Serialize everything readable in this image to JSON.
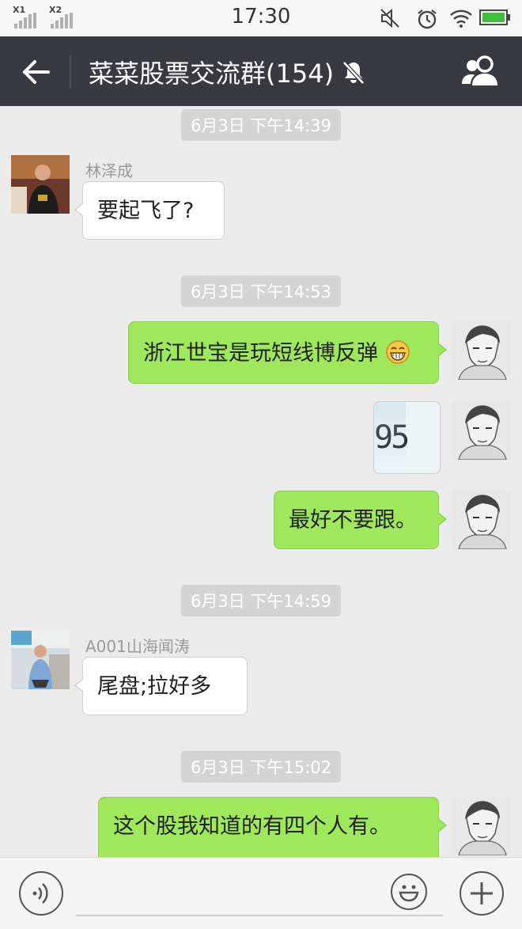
{
  "status_bar": {
    "time": "17:30",
    "sim1_label": "X1",
    "sim2_label": "X2",
    "icons": [
      "signal-icon",
      "signal-icon",
      "mute-icon",
      "alarm-icon",
      "wifi-icon",
      "battery-icon"
    ]
  },
  "header": {
    "title": "菜菜股票交流群(154)",
    "icons": [
      "back-arrow-icon",
      "mute-bell-icon",
      "group-members-icon"
    ]
  },
  "messages": [
    {
      "type": "timestamp",
      "text": "6月3日 下午14:39"
    },
    {
      "type": "message",
      "side": "left",
      "sender": "林泽成",
      "text": "要起飞了?"
    },
    {
      "type": "timestamp",
      "text": "6月3日 下午14:53"
    },
    {
      "type": "message",
      "side": "right",
      "text": "浙江世宝是玩短线博反弹",
      "emoji": "grin-emoji"
    },
    {
      "type": "image",
      "side": "right",
      "image_text": "95"
    },
    {
      "type": "message",
      "side": "right",
      "text": "最好不要跟。"
    },
    {
      "type": "timestamp",
      "text": "6月3日 下午14:59"
    },
    {
      "type": "message",
      "side": "left",
      "sender": "A001山海闻涛",
      "text": "尾盘;拉好多"
    },
    {
      "type": "timestamp",
      "text": "6月3日 下午15:02"
    },
    {
      "type": "message",
      "side": "right",
      "text": "这个股我知道的有四个人有。"
    }
  ],
  "input_bar": {
    "icons": [
      "voice-icon",
      "emoji-icon",
      "plus-icon"
    ]
  },
  "colors": {
    "titlebar": "#393a3f",
    "background": "#ebebeb",
    "sent_bubble": "#9fe75b",
    "received_bubble": "#ffffff"
  }
}
